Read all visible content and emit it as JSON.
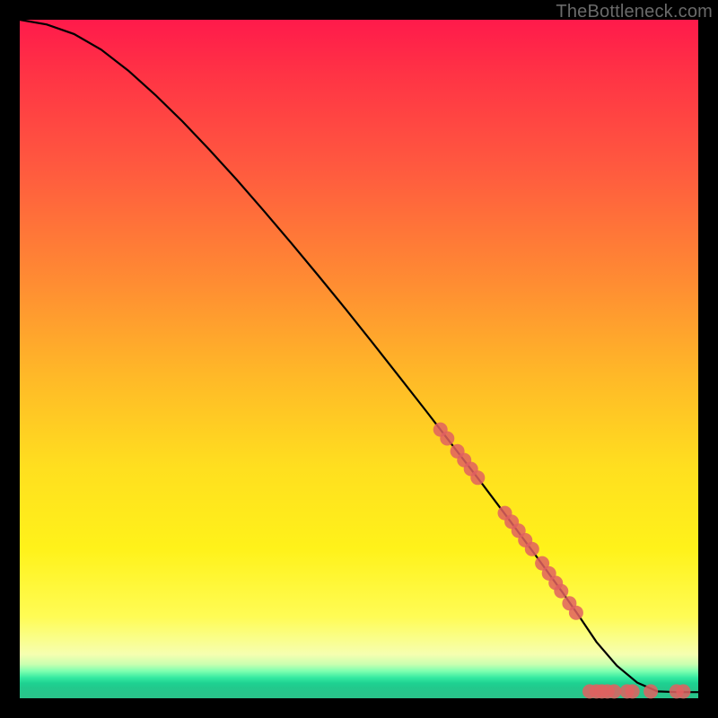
{
  "watermark": "TheBottleneck.com",
  "chart_data": {
    "type": "line",
    "title": "",
    "xlabel": "",
    "ylabel": "",
    "xlim": [
      0,
      100
    ],
    "ylim": [
      0,
      100
    ],
    "curve": {
      "x": [
        0,
        4,
        8,
        12,
        16,
        20,
        24,
        28,
        32,
        36,
        40,
        44,
        48,
        52,
        56,
        60,
        64,
        68,
        72,
        76,
        80,
        82.5,
        85,
        88,
        91,
        94,
        97,
        100
      ],
      "y": [
        100,
        99.3,
        97.9,
        95.6,
        92.5,
        88.9,
        85.0,
        80.8,
        76.4,
        71.8,
        67.1,
        62.3,
        57.4,
        52.4,
        47.3,
        42.2,
        37.0,
        31.8,
        26.5,
        21.1,
        15.6,
        12.0,
        8.3,
        4.8,
        2.3,
        1.0,
        0.9,
        0.9
      ]
    },
    "points": {
      "comment": "salmon markers clustered on lower-right portion of the curve and along the floor",
      "x": [
        62,
        63,
        64.5,
        65.5,
        66.5,
        67.5,
        71.5,
        72.5,
        73.5,
        74.5,
        75.5,
        77,
        78,
        79,
        79.8,
        81,
        82,
        84,
        85,
        85.8,
        86.6,
        87.6,
        89.5,
        90.3,
        93.0,
        96.8,
        97.8
      ],
      "y": [
        39.6,
        38.3,
        36.4,
        35.1,
        33.8,
        32.5,
        27.3,
        26.0,
        24.7,
        23.3,
        22.0,
        19.9,
        18.4,
        17.0,
        15.8,
        14.0,
        12.6,
        1.0,
        1.0,
        1.0,
        1.0,
        1.0,
        1.0,
        1.0,
        1.0,
        1.0,
        1.0
      ]
    },
    "colors": {
      "curve": "#000000",
      "points": "#e06060",
      "gradient_top": "#ff1a4b",
      "gradient_bottom": "#2ac38a"
    }
  }
}
